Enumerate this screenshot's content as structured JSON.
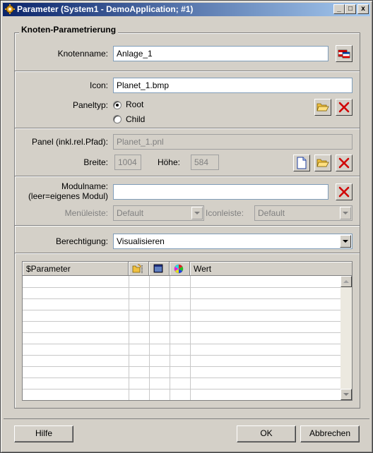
{
  "window": {
    "title": "Parameter (System1 - DemoApplication; #1)",
    "minimize": "_",
    "maximize": "□",
    "close": "x"
  },
  "group": {
    "title": "Knoten-Parametrierung"
  },
  "node": {
    "label": "Knotenname:",
    "value": "Anlage_1"
  },
  "icon": {
    "label": "Icon:",
    "value": "Planet_1.bmp"
  },
  "paneltype": {
    "label": "Paneltyp:",
    "options": [
      {
        "label": "Root",
        "selected": true
      },
      {
        "label": "Child",
        "selected": false
      }
    ]
  },
  "panel": {
    "label": "Panel (inkl.rel.Pfad):",
    "value": "Planet_1.pnl",
    "width_label": "Breite:",
    "width_value": "1004",
    "height_label": "Höhe:",
    "height_value": "584"
  },
  "module": {
    "label_line1": "Modulname:",
    "label_line2": "(leer=eigenes Modul)",
    "value": "",
    "menubar_label": "Menüleiste:",
    "menubar_value": "Default",
    "iconbar_label": "Iconleiste:",
    "iconbar_value": "Default"
  },
  "permission": {
    "label": "Berechtigung:",
    "value": "Visualisieren"
  },
  "table": {
    "columns": [
      {
        "label": "$Parameter",
        "icon": ""
      },
      {
        "label": "",
        "icon": "folder-arrow-icon"
      },
      {
        "label": "",
        "icon": "window-icon"
      },
      {
        "label": "",
        "icon": "color-icon"
      },
      {
        "label": "Wert",
        "icon": ""
      }
    ],
    "rows": []
  },
  "buttons": {
    "help": "Hilfe",
    "ok": "OK",
    "cancel": "Abbrechen"
  }
}
